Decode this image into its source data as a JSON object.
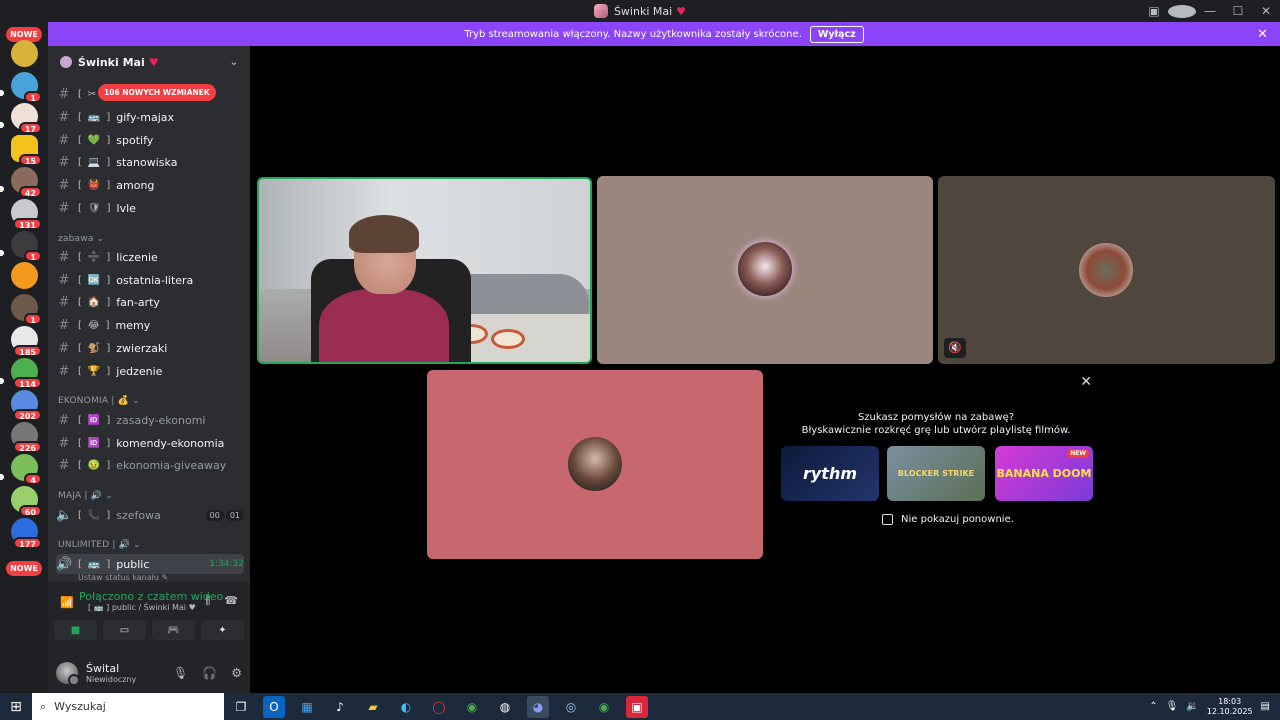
{
  "window": {
    "title": "Świnki Mai",
    "title_heart": "♥"
  },
  "titlebar_icons": [
    "screen-share-icon",
    "help-icon",
    "minimize-icon",
    "maximize-icon",
    "close-icon"
  ],
  "banner": {
    "text": "Tryb streamowania włączony. Nazwy użytkownika zostały skrócone.",
    "button": "Wyłącz"
  },
  "server_rail": {
    "top_badge": "NOWE",
    "bottom_badge": "NOWE",
    "badges": [
      "1",
      "17",
      "15",
      "42",
      "131",
      "1",
      "",
      "1",
      "185",
      "114",
      "202",
      "226",
      "4",
      "60",
      "177"
    ]
  },
  "server": {
    "name": "Świnki Mai",
    "heart": "♥"
  },
  "mention_pill": "106 NOWYCH WZMIANEK",
  "channels_top": [
    {
      "prefix": "[",
      "suffix": "]",
      "name": "",
      "emoji": "✂"
    },
    {
      "prefix": "[",
      "suffix": "]",
      "name": "gify-majax",
      "emoji": "🚌"
    },
    {
      "prefix": "[",
      "suffix": "]",
      "name": "spotify",
      "emoji": "💚"
    },
    {
      "prefix": "[",
      "suffix": "]",
      "name": "stanowiska",
      "emoji": "💻"
    },
    {
      "prefix": "[",
      "suffix": "]",
      "name": "among",
      "emoji": "👹"
    },
    {
      "prefix": "[",
      "suffix": "]",
      "name": "lvle",
      "emoji": "🛡"
    }
  ],
  "category_zabawa": "zabawa",
  "channels_zabawa": [
    {
      "prefix": "[",
      "suffix": "]",
      "name": "liczenie",
      "emoji": "➗"
    },
    {
      "prefix": "[",
      "suffix": "]",
      "name": "ostatnia-litera",
      "emoji": "🆗"
    },
    {
      "prefix": "[",
      "suffix": "]",
      "name": "fan-arty",
      "emoji": "🏠"
    },
    {
      "prefix": "[",
      "suffix": "]",
      "name": "memy",
      "emoji": "😂"
    },
    {
      "prefix": "[",
      "suffix": "]",
      "name": "zwierzaki",
      "emoji": "🐒"
    },
    {
      "prefix": "[",
      "suffix": "]",
      "name": "jedzenie",
      "emoji": "🏆"
    }
  ],
  "category_ekonomia": "EKONOMIA |",
  "channels_ekonomia": [
    {
      "prefix": "[",
      "suffix": "]",
      "name": "zasady-ekonomi",
      "emoji": "🆔",
      "muted": true
    },
    {
      "prefix": "[",
      "suffix": "]",
      "name": "komendy-ekonomia",
      "emoji": "🆔",
      "muted": false
    },
    {
      "prefix": "[",
      "suffix": "]",
      "name": "ekonomia-giveaway",
      "emoji": "🤢",
      "muted": true
    }
  ],
  "category_maja": "MAJA |",
  "voice_szefowa": {
    "prefix": "[",
    "suffix": "]",
    "name": "szefowa",
    "count_a": "00",
    "count_b": "01"
  },
  "category_unlimited": "UNLIMITED |",
  "voice_public": {
    "prefix": "[",
    "suffix": "]",
    "name": "public",
    "timer": "1:34:32",
    "status_hint": "Ustaw status kanału"
  },
  "voice_panel": {
    "title": "Połączono z czatem wideo",
    "subtitle": "[ 🚌 ]  public / Świnki Mai ♥"
  },
  "user": {
    "name": "Śwital",
    "status": "Niewidoczny"
  },
  "promo": {
    "line1": "Szukasz pomysłów na zabawę?",
    "line2": "Błyskawicznie rozkręć grę lub utwórz playlistę filmów.",
    "cards": [
      "rythm",
      "BLOCKER STRIKE",
      "BANANA DOOM"
    ],
    "new_tag": "NEW",
    "checkbox": "Nie pokazuj ponownie."
  },
  "taskbar": {
    "search": "Wyszukaj",
    "time": "18:03",
    "date": "12.10.2025"
  },
  "colors": {
    "accent_purple": "#8b44f7",
    "green": "#23a55a",
    "red": "#f23f43",
    "tile_pink": "#c8676d",
    "tile_beige": "#9a867c",
    "tile_brown": "#4f463e"
  }
}
